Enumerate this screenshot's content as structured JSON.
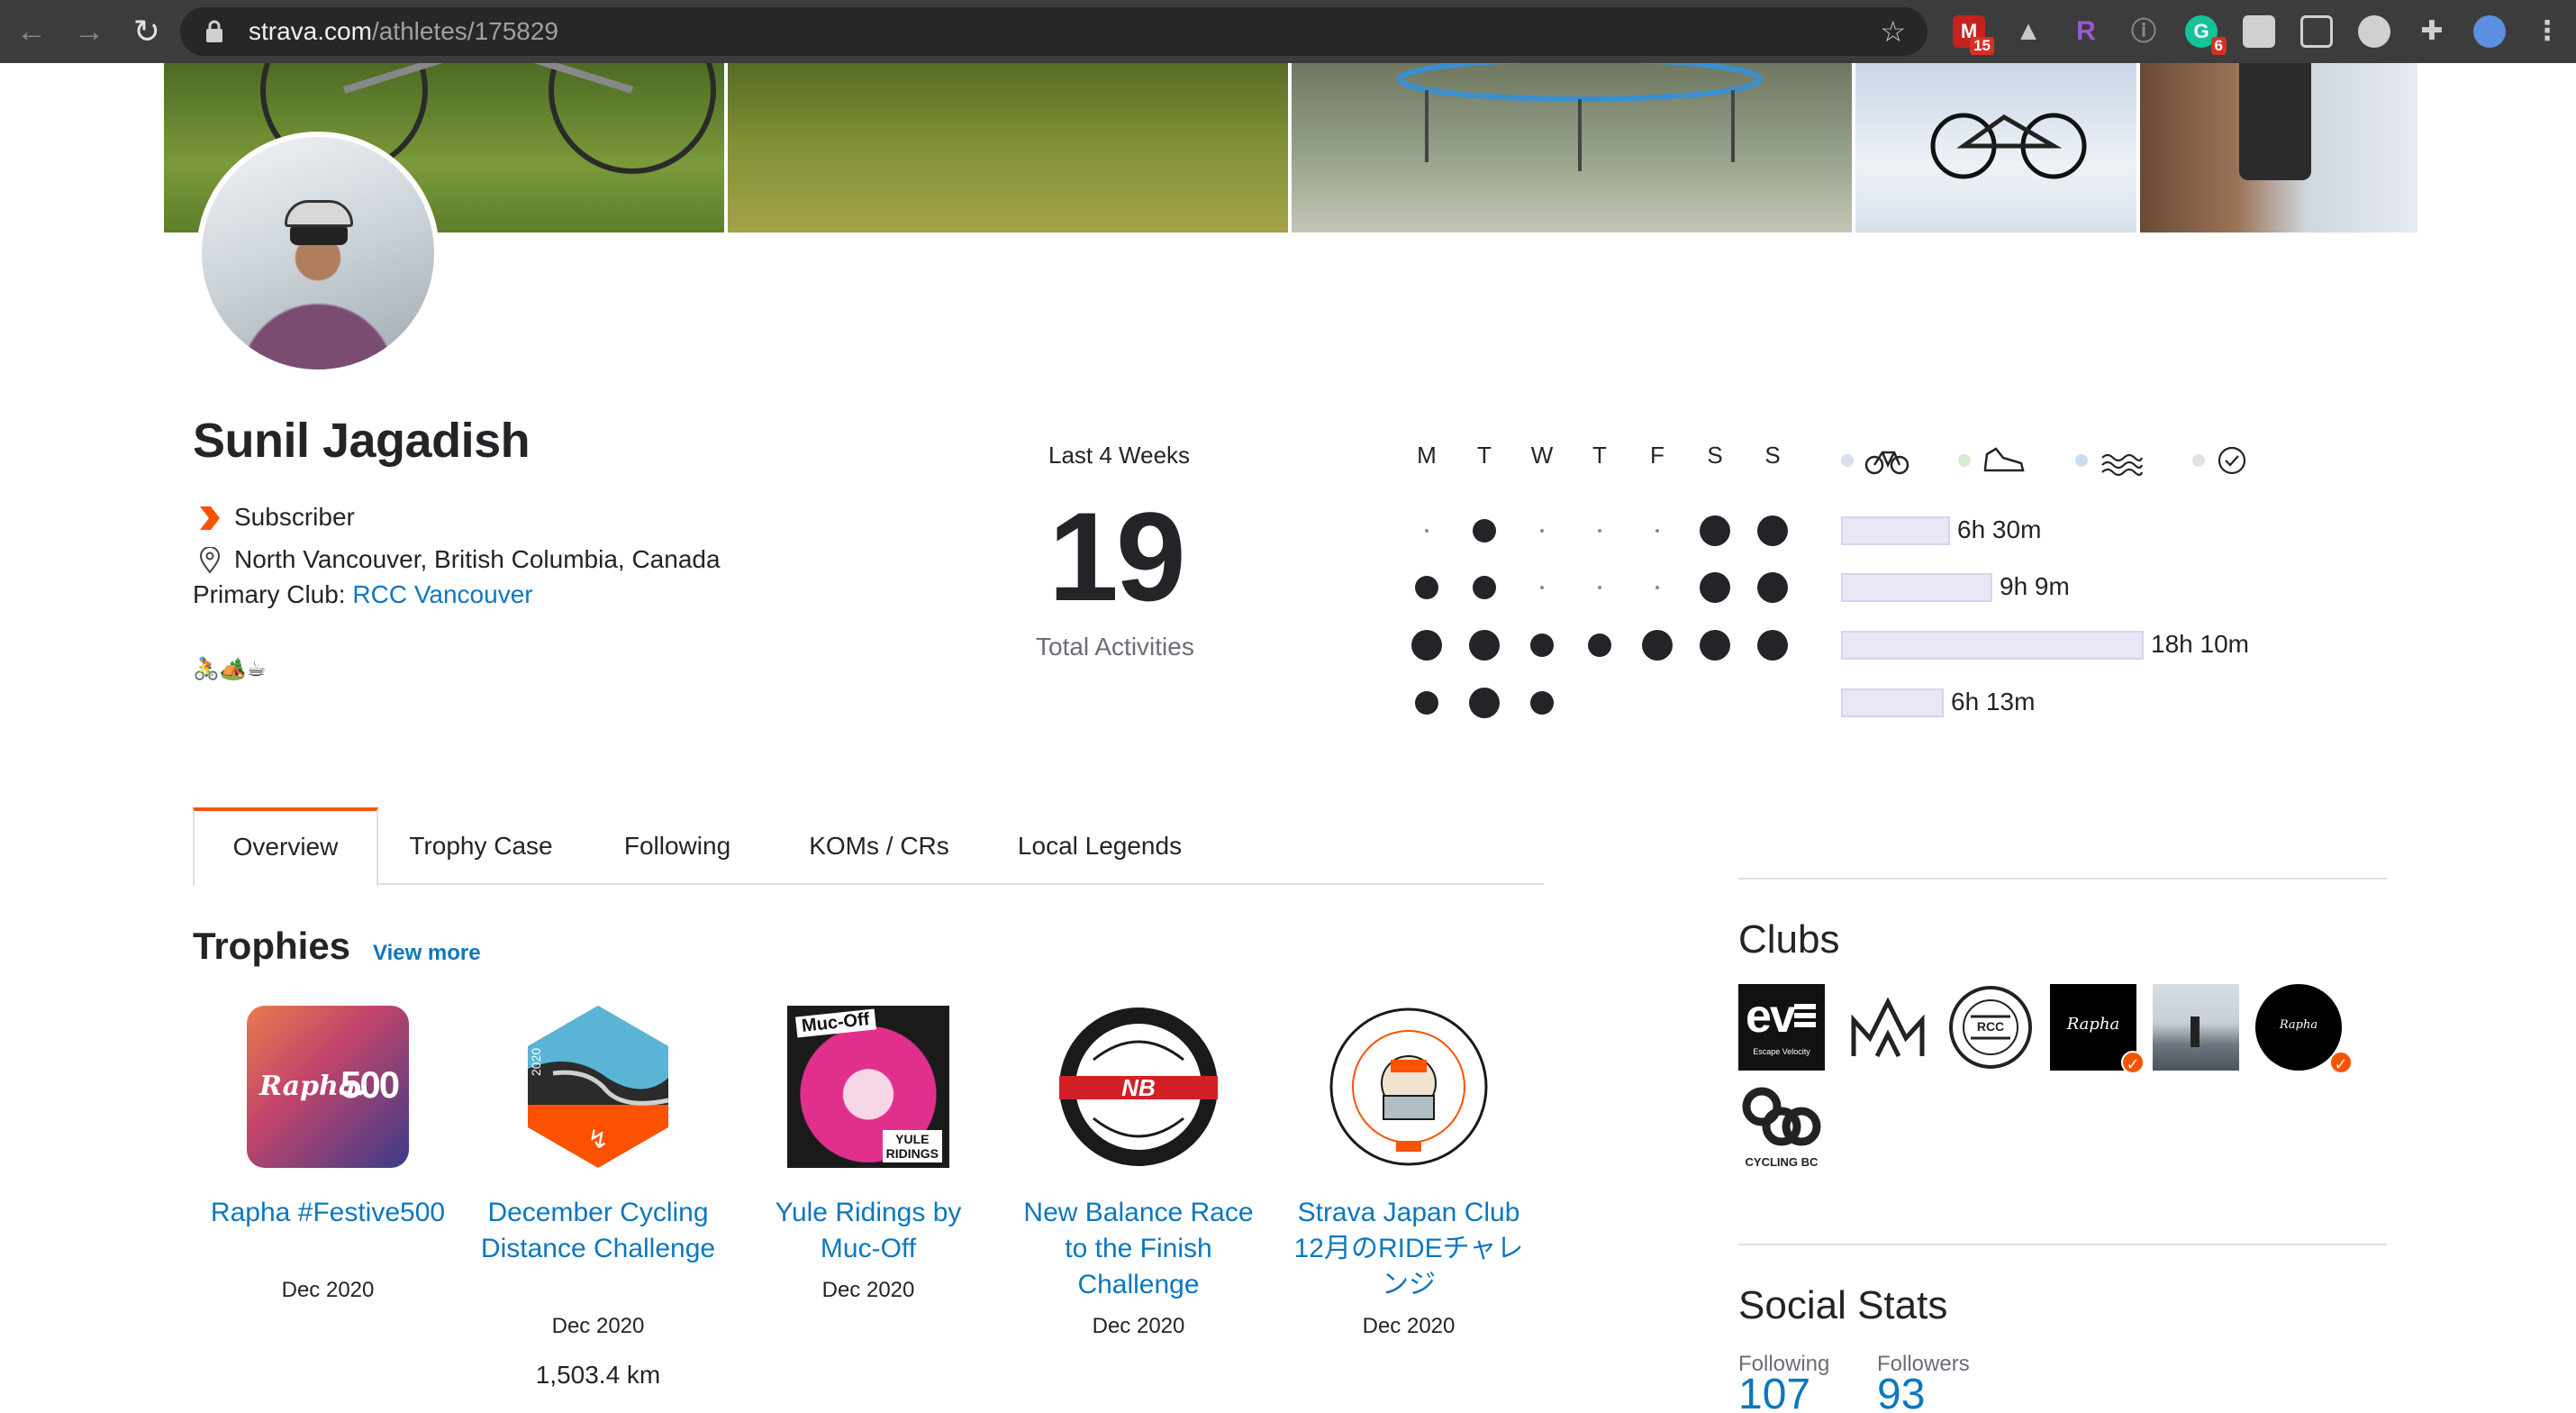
{
  "browser": {
    "url_host": "strava.com",
    "url_path": "/athletes/175829",
    "extension_badges": {
      "gmail": "15",
      "grammarly": "6"
    },
    "extension_letter": "R"
  },
  "profile": {
    "name": "Sunil Jagadish",
    "subscriber_label": "Subscriber",
    "location": "North Vancouver, British Columbia, Canada",
    "primary_club_label": "Primary Club:",
    "primary_club_name": "RCC Vancouver",
    "emojis": "🚴🏕️☕"
  },
  "last4weeks": {
    "label": "Last 4 Weeks",
    "count": "19",
    "sublabel": "Total Activities",
    "days": [
      "M",
      "T",
      "W",
      "T",
      "F",
      "S",
      "S"
    ],
    "weeks": [
      {
        "dots": [
          0,
          2,
          0,
          0,
          0,
          3,
          3
        ],
        "duration": "6h 30m",
        "fraction": 0.36
      },
      {
        "dots": [
          2,
          2,
          0,
          0,
          0,
          3,
          3
        ],
        "duration": "9h 9m",
        "fraction": 0.5
      },
      {
        "dots": [
          3,
          3,
          2,
          2,
          3,
          3,
          3
        ],
        "duration": "18h 10m",
        "fraction": 1.0
      },
      {
        "dots": [
          2,
          3,
          2
        ],
        "duration": "6h 13m",
        "fraction": 0.34
      }
    ],
    "sport_keys": [
      {
        "icon": "bike-icon",
        "color": "#dcdff0"
      },
      {
        "icon": "shoe-icon",
        "color": "#d6ebcf"
      },
      {
        "icon": "swim-icon",
        "color": "#c9dff0"
      },
      {
        "icon": "check-icon",
        "color": "#e2e2e2"
      }
    ]
  },
  "tabs": [
    "Overview",
    "Trophy Case",
    "Following",
    "KOMs / CRs",
    "Local Legends"
  ],
  "trophies": {
    "title": "Trophies",
    "view_more": "View more",
    "items": [
      {
        "name": "Rapha #Festive500",
        "date": "Dec 2020",
        "distance": ""
      },
      {
        "name": "December Cycling Distance Challenge",
        "date": "Dec 2020",
        "distance": "1,503.4 km"
      },
      {
        "name": "Yule Ridings by Muc-Off",
        "date": "Dec 2020",
        "distance": ""
      },
      {
        "name": "New Balance Race to the Finish Challenge",
        "date": "Dec 2020",
        "distance": ""
      },
      {
        "name": "Strava Japan Club 12月のRIDEチャレンジ",
        "date": "Dec 2020",
        "distance": ""
      }
    ]
  },
  "clubs": {
    "title": "Clubs",
    "logos": {
      "ev": "ev",
      "ev_sub": "Escape Velocity",
      "rcc": "RCC",
      "rapha": "Rapha",
      "rapha_cc": "Rapha",
      "cycling_bc": "CYCLING BC"
    }
  },
  "social": {
    "title": "Social Stats",
    "following_label": "Following",
    "following_value": "107",
    "followers_label": "Followers",
    "followers_value": "93"
  },
  "colors": {
    "brand": "#fc5200",
    "link": "#0c77bf",
    "text": "#242428",
    "bar_fill": "#ebe6f5"
  }
}
